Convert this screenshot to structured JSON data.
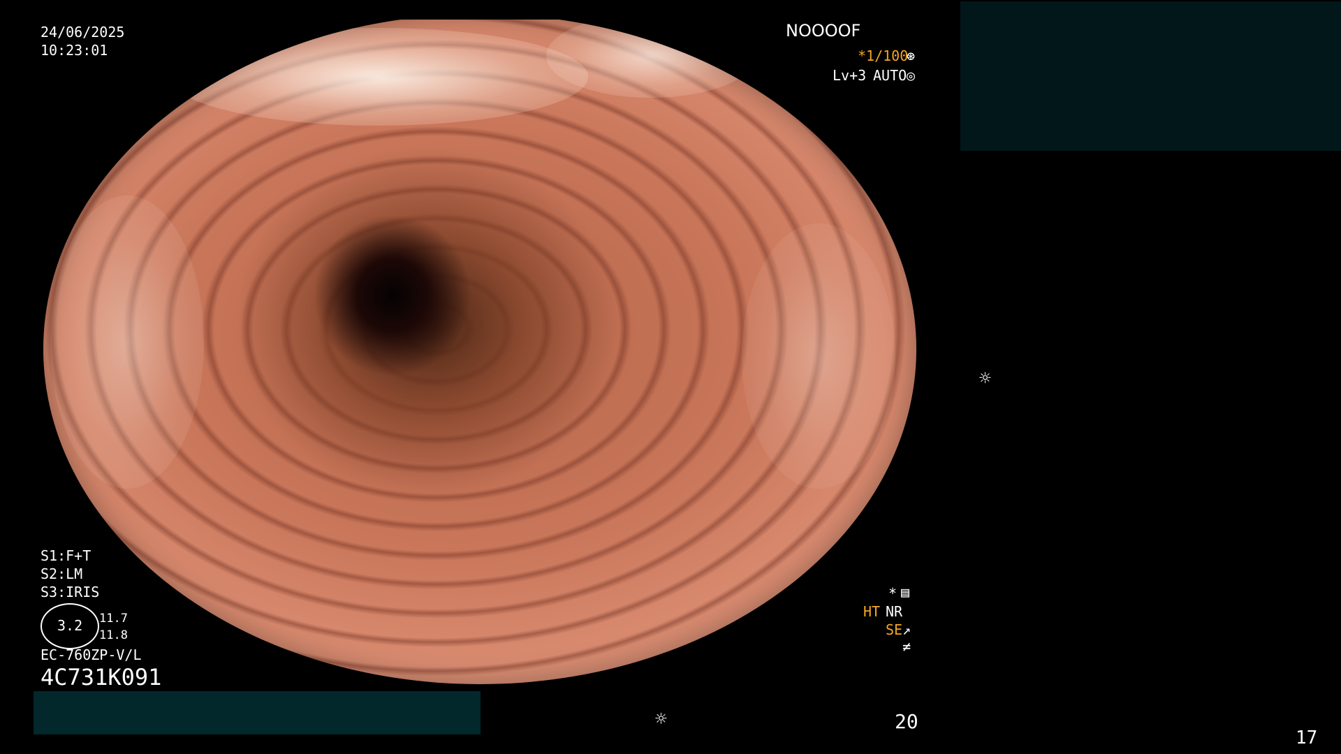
{
  "info": {
    "date": "24/06/2025",
    "time": "10:23:01",
    "status_code": "NOOOOF",
    "shutter": "*1/100",
    "level": "Lv+3",
    "mode": "AUTO"
  },
  "settings": {
    "s1": "S1:F+T",
    "s2": "S2:LM",
    "s3": "S3:IRIS",
    "gauge_value": "3.2",
    "gauge_upper": "11.7",
    "gauge_lower": "11.8",
    "scope_model": "EC-760ZP-V/L",
    "serial": "4C731K091"
  },
  "indicators": {
    "star": "*",
    "ht": "HT",
    "nr": "NR",
    "se": "SE"
  },
  "footer": {
    "count": "20",
    "page": "17"
  },
  "colors": {
    "accent_orange": "#f5a623",
    "panel_teal": "#02171a"
  }
}
